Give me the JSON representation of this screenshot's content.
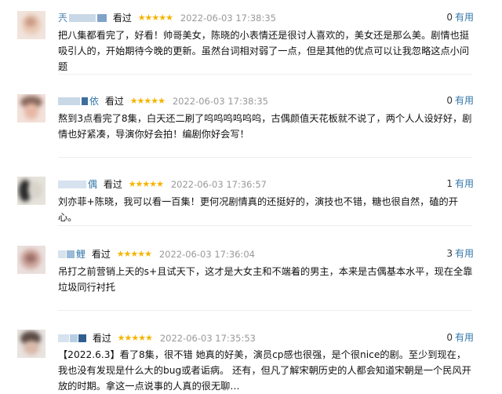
{
  "theme": {
    "link_color": "#3377aa",
    "star_color": "#f5b400",
    "meta_gray": "#999999"
  },
  "reviews": [
    {
      "user": "兲",
      "status": "看过",
      "stars": "★★★★★",
      "time": "2022-06-03 17:38:35",
      "useful_count": "0",
      "useful_label": "有用",
      "content": "把八集都看完了，好看！帅哥美女，陈晓的小表情还是很讨人喜欢的，美女还是那么美。剧情也挺吸引人的，开始期待今晚的更新。虽然台词相对弱了一点，但是其他的优点可以让我忽略这点小问题"
    },
    {
      "user": "依",
      "status": "看过",
      "stars": "★★★★★",
      "time": "2022-06-03 17:38:35",
      "useful_count": "0",
      "useful_label": "有用",
      "content": "熬到3点看完了8集，白天还二刷了呜呜呜呜呜呜，古偶颜值天花板就不说了，两个人人设好好，剧情也好紧凑，导演你好会拍！编剧你好会写！"
    },
    {
      "user": "偶",
      "status": "看过",
      "stars": "★★★★★",
      "time": "2022-06-03 17:36:57",
      "useful_count": "1",
      "useful_label": "有用",
      "content": "刘亦菲+陈晓，我可以看一百集！更何况剧情真的还挺好的，演技也不错，糖也很自然，磕的开心。"
    },
    {
      "user": "鲤",
      "status": "看过",
      "stars": "★★★★★",
      "time": "2022-06-03 17:36:04",
      "useful_count": "3",
      "useful_label": "有用",
      "content": "吊打之前营销上天的s+且试天下，这才是大女主和不端着的男主，本来是古偶基本水平，现在全靠垃圾同行衬托"
    },
    {
      "user": "",
      "status": "看过",
      "stars": "★★★★★",
      "time": "2022-06-03 17:35:53",
      "useful_count": "0",
      "useful_label": "有用",
      "content": "【2022.6.3】看了8集，很不错 她真的好美，演员cp感也很强，是个很nice的剧。至少到现在，我也没有发现是什么大的bug或者诟病。 还有，但凡了解宋朝历史的人都会知道宋朝是一个民风开放的时期。拿这一点说事的人真的很无聊…"
    }
  ]
}
